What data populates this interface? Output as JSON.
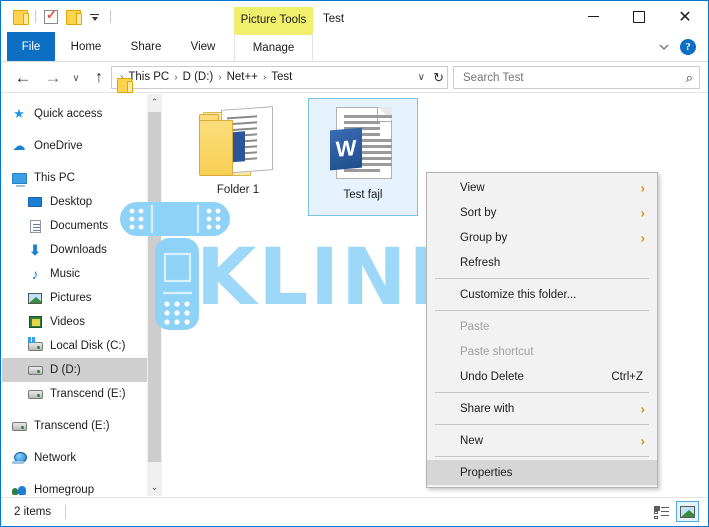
{
  "window": {
    "title": "Test",
    "contextual_tab_label": "Picture Tools",
    "accent_color": "#0d6fc4",
    "contextual_tab_color": "#f0f06e"
  },
  "quick_access_toolbar": {
    "items": [
      {
        "name": "folder-icon",
        "label": ""
      },
      {
        "name": "properties-icon",
        "label": ""
      },
      {
        "name": "new-folder-icon",
        "label": ""
      },
      {
        "name": "customize-dropdown-icon",
        "label": ""
      }
    ]
  },
  "window_controls": {
    "minimize": "—",
    "maximize": "□",
    "close": "✕"
  },
  "ribbon": {
    "tabs": [
      {
        "label": "File",
        "active": true
      },
      {
        "label": "Home",
        "active": false
      },
      {
        "label": "Share",
        "active": false
      },
      {
        "label": "View",
        "active": false
      },
      {
        "label": "Manage",
        "active": false,
        "contextual": true
      }
    ],
    "collapse_icon": "chevron-down-icon",
    "help_label": "?"
  },
  "addressbar": {
    "back_icon": "←",
    "forward_icon": "→",
    "recent_icon": "∨",
    "up_icon": "↑",
    "breadcrumb": [
      "This PC",
      "D (D:)",
      "Net++",
      "Test"
    ],
    "separator": "›",
    "dropdown_icon": "∨",
    "refresh_icon": "↻"
  },
  "search": {
    "placeholder": "Search Test",
    "value": "",
    "icon": "⌕"
  },
  "sidebar": {
    "items": [
      {
        "label": "Quick access",
        "icon": "star-icon",
        "level": "root",
        "selected": false,
        "gap_after": true
      },
      {
        "label": "OneDrive",
        "icon": "cloud-icon",
        "level": "root",
        "selected": false,
        "gap_after": true
      },
      {
        "label": "This PC",
        "icon": "monitor-icon",
        "level": "root",
        "selected": false,
        "gap_after": false
      },
      {
        "label": "Desktop",
        "icon": "desktop-icon",
        "level": "indent",
        "selected": false,
        "gap_after": false
      },
      {
        "label": "Documents",
        "icon": "document-icon",
        "level": "indent",
        "selected": false,
        "gap_after": false
      },
      {
        "label": "Downloads",
        "icon": "download-icon",
        "level": "indent",
        "selected": false,
        "gap_after": false
      },
      {
        "label": "Music",
        "icon": "music-icon",
        "level": "indent",
        "selected": false,
        "gap_after": false
      },
      {
        "label": "Pictures",
        "icon": "pictures-icon",
        "level": "indent",
        "selected": false,
        "gap_after": false
      },
      {
        "label": "Videos",
        "icon": "videos-icon",
        "level": "indent",
        "selected": false,
        "gap_after": false
      },
      {
        "label": "Local Disk (C:)",
        "icon": "drive-windows-icon",
        "level": "indent",
        "selected": false,
        "gap_after": false
      },
      {
        "label": "D (D:)",
        "icon": "drive-icon",
        "level": "indent",
        "selected": true,
        "gap_after": false
      },
      {
        "label": "Transcend (E:)",
        "icon": "drive-icon",
        "level": "indent",
        "selected": false,
        "gap_after": true
      },
      {
        "label": "Transcend (E:)",
        "icon": "drive-icon",
        "level": "root",
        "selected": false,
        "gap_after": true
      },
      {
        "label": "Network",
        "icon": "network-icon",
        "level": "root",
        "selected": false,
        "gap_after": true
      },
      {
        "label": "Homegroup",
        "icon": "homegroup-icon",
        "level": "root",
        "selected": false,
        "gap_after": false
      }
    ],
    "scroll_up_icon": "⌃",
    "scroll_down_icon": "⌄"
  },
  "content": {
    "files": [
      {
        "name": "Folder 1",
        "type": "folder",
        "selected": false
      },
      {
        "name": "Test fajl",
        "type": "word-document",
        "selected": true
      }
    ],
    "word_letter": "W"
  },
  "watermark": {
    "text": "KLINIKA",
    "color": "#8ed2f7",
    "logo_name": "phone-bandage-logo"
  },
  "context_menu": {
    "items": [
      {
        "label": "View",
        "type": "submenu",
        "disabled": false,
        "highlighted": false,
        "accel": ""
      },
      {
        "label": "Sort by",
        "type": "submenu",
        "disabled": false,
        "highlighted": false,
        "accel": ""
      },
      {
        "label": "Group by",
        "type": "submenu",
        "disabled": false,
        "highlighted": false,
        "accel": ""
      },
      {
        "label": "Refresh",
        "type": "item",
        "disabled": false,
        "highlighted": false,
        "accel": ""
      },
      {
        "type": "separator"
      },
      {
        "label": "Customize this folder...",
        "type": "item",
        "disabled": false,
        "highlighted": false,
        "accel": ""
      },
      {
        "type": "separator"
      },
      {
        "label": "Paste",
        "type": "item",
        "disabled": true,
        "highlighted": false,
        "accel": ""
      },
      {
        "label": "Paste shortcut",
        "type": "item",
        "disabled": true,
        "highlighted": false,
        "accel": ""
      },
      {
        "label": "Undo Delete",
        "type": "item",
        "disabled": false,
        "highlighted": false,
        "accel": "Ctrl+Z"
      },
      {
        "type": "separator"
      },
      {
        "label": "Share with",
        "type": "submenu",
        "disabled": false,
        "highlighted": false,
        "accel": ""
      },
      {
        "type": "separator"
      },
      {
        "label": "New",
        "type": "submenu",
        "disabled": false,
        "highlighted": false,
        "accel": ""
      },
      {
        "type": "separator"
      },
      {
        "label": "Properties",
        "type": "item",
        "disabled": false,
        "highlighted": true,
        "accel": ""
      }
    ],
    "submenu_arrow": "›",
    "submenu_arrow_color": "#d98c1f"
  },
  "statusbar": {
    "item_count": "2 items",
    "view_buttons": [
      {
        "name": "details-view-button",
        "active": false
      },
      {
        "name": "large-icons-view-button",
        "active": true
      }
    ]
  }
}
